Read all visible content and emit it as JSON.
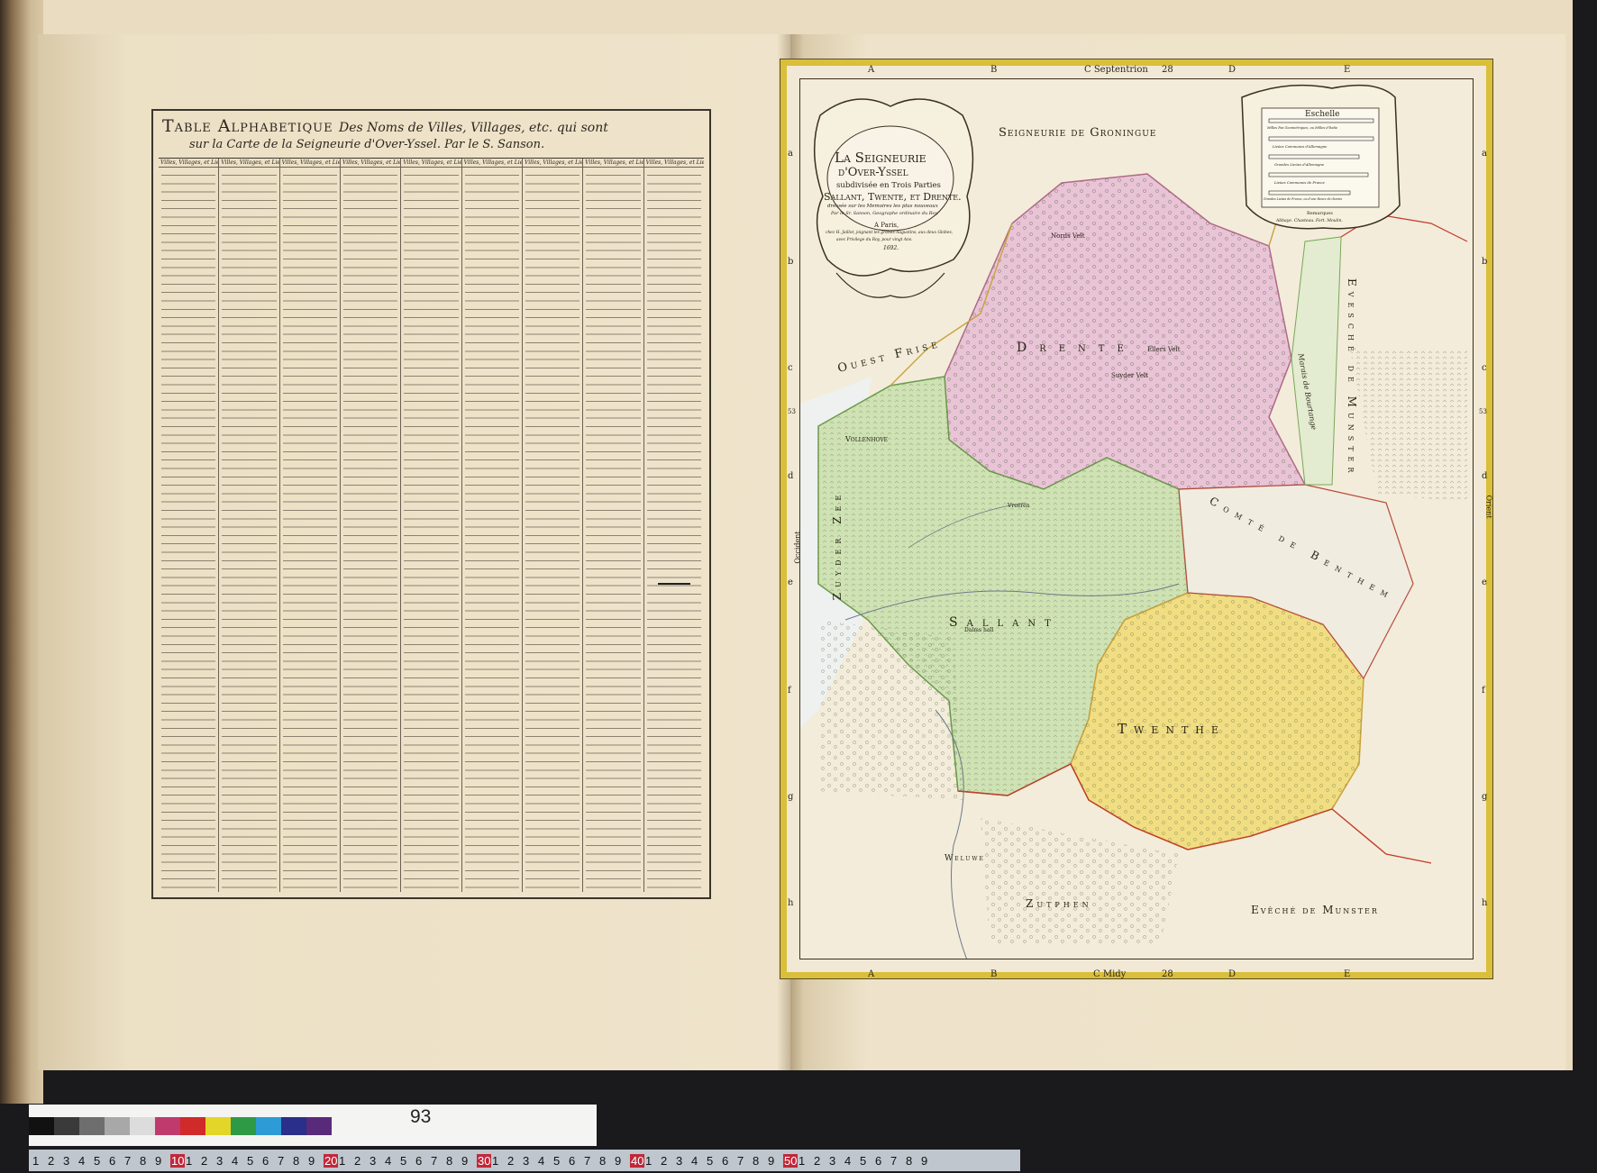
{
  "table": {
    "title": "Table Alphabetique",
    "title_rest": "Des Noms de Villes, Villages, etc. qui sont",
    "subtitle": "sur la Carte de la Seigneurie d'Over-Yssel. Par le S. Sanson.",
    "column_header": "Villes, Villages, et Lieux"
  },
  "map": {
    "cartouche": {
      "line1": "La Seigneurie",
      "line2": "d'Over-Yssel",
      "line3": "subdivisée en Trois Parties",
      "line4": "Sallant, Twente, et Drente.",
      "line5": "dressée sur les Memoires les plus nouveaux",
      "line6": "Par le Sr. Sanson, Geographe ordinaire du Roy.",
      "line7": "A Paris,",
      "line8": "chez H. Jaillot, joignant les grands Augustins, aux deux Globes,",
      "line9": "avec Privilege du Roy, pour vingt Ans.",
      "line10": "1692."
    },
    "scale": {
      "title": "Eschelle",
      "l1": "Milles Pas Geometriques, ou Milles d'Italie",
      "l2": "Lieües Communes d'Allemagne",
      "l3": "Grandes Lieües d'Allemagne",
      "l4": "Lieües Communes de France",
      "l5": "Grandes Lieües de France, ou d'une Heure de chemin",
      "remarks_title": "Remarques",
      "remarks": "Abbaye. Chasteau. Fort. Moulin."
    },
    "regions": {
      "groningue": "Seigneurie de Groningue",
      "drente": "Drente",
      "ouest_frise": "Ouest Frise",
      "vollenhove": "Vollenhove",
      "sallant": "Sallant",
      "twenthe": "Twenthe",
      "weluwe": "Weluwe",
      "zutphen": "Zutphen",
      "comte": "Comté de Benthem",
      "munster_e": "Evesché de Munster",
      "munster_s": "Evêché de Munster",
      "zuyder": "Zuyder Zee",
      "bourtange": "Marais de Bourtange",
      "nords_velt": "Nords Velt",
      "ellers_velt": "Ellers Velt",
      "suyder_velt": "Suyder Velt",
      "dalms_hall": "Dalms hall",
      "vreeren": "Vreeren"
    },
    "edge_labels": {
      "top": [
        "A",
        "B",
        "C Septentrion",
        "28",
        "D",
        "E"
      ],
      "bottom": [
        "A",
        "B",
        "C Midy",
        "28",
        "D",
        "E"
      ],
      "left": [
        "a",
        "b",
        "c",
        "d",
        "e",
        "f",
        "g",
        "h"
      ],
      "right": [
        "a",
        "b",
        "c",
        "d",
        "e",
        "f",
        "g",
        "h"
      ],
      "side_west": "Occident",
      "side_east": "Orient",
      "lat": "53"
    },
    "colors": {
      "drente": "#e9c3d6",
      "sallant": "#cfe2b3",
      "twente": "#f1dd82",
      "border_gold": "#d9bf3a"
    }
  },
  "page_number": "93",
  "ruler": {
    "labels": [
      "1",
      "2",
      "3",
      "4",
      "5",
      "6",
      "7",
      "8",
      "9",
      "10",
      "1",
      "2",
      "3",
      "4",
      "5",
      "6",
      "7",
      "8",
      "9",
      "20",
      "1",
      "2",
      "3",
      "4",
      "5",
      "6",
      "7",
      "8",
      "9",
      "30",
      "1",
      "2",
      "3",
      "4",
      "5",
      "6",
      "7",
      "8",
      "9",
      "40",
      "1",
      "2",
      "3",
      "4",
      "5",
      "6",
      "7",
      "8",
      "9",
      "50",
      "1",
      "2",
      "3",
      "4",
      "5",
      "6",
      "7",
      "8",
      "9"
    ]
  },
  "color_chart": [
    "#111111",
    "#3a3a3a",
    "#6e6e6e",
    "#a8a8a8",
    "#dcdcdc",
    "#c03a6e",
    "#d12a2a",
    "#e3d628",
    "#2f9a46",
    "#2d9bd6",
    "#2a2f8a",
    "#5a2a7a"
  ]
}
